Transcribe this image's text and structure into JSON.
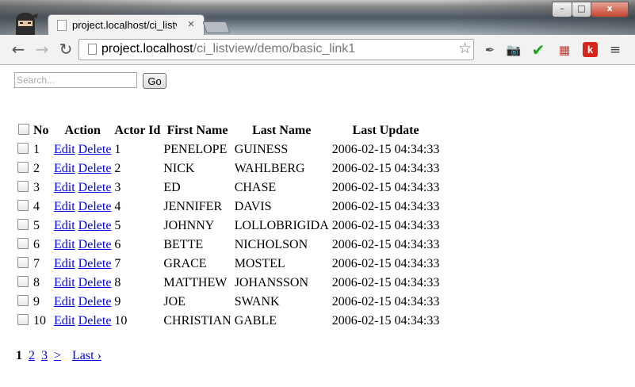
{
  "browser": {
    "tab_title": "project.localhost/ci_listview/demo/basic_link1",
    "tab_close": "×",
    "url_host": "project.localhost",
    "url_path": "/ci_listview/demo/basic_link1",
    "window_buttons": {
      "minimize": "–",
      "maximize": "□",
      "close": "x"
    },
    "nav": {
      "back": "←",
      "forward": "→",
      "reload": "↻"
    },
    "star": "☆",
    "extensions": [
      {
        "name": "eyedropper-extension",
        "glyph": "✒",
        "color": "#555555"
      },
      {
        "name": "camera-extension",
        "glyph": "📷",
        "color": "#2d4e8a"
      },
      {
        "name": "checkmark-extension",
        "glyph": "✔",
        "color": "#1aa51a"
      },
      {
        "name": "colorzilla-extension",
        "glyph": "▦",
        "color": "#c0392b"
      },
      {
        "name": "k-extension",
        "glyph": "k",
        "color": "#ffffff"
      }
    ],
    "menu": "≡"
  },
  "search": {
    "placeholder": "Search...",
    "value": "",
    "go_label": "Go"
  },
  "table": {
    "headers": {
      "no": "No",
      "action": "Action",
      "actor_id": "Actor Id",
      "first_name": "First Name",
      "last_name": "Last Name",
      "last_update": "Last Update"
    },
    "edit_label": "Edit",
    "delete_label": "Delete",
    "rows": [
      {
        "no": "1",
        "actor_id": "1",
        "first_name": "PENELOPE",
        "last_name": "GUINESS",
        "last_update": "2006-02-15 04:34:33"
      },
      {
        "no": "2",
        "actor_id": "2",
        "first_name": "NICK",
        "last_name": "WAHLBERG",
        "last_update": "2006-02-15 04:34:33"
      },
      {
        "no": "3",
        "actor_id": "3",
        "first_name": "ED",
        "last_name": "CHASE",
        "last_update": "2006-02-15 04:34:33"
      },
      {
        "no": "4",
        "actor_id": "4",
        "first_name": "JENNIFER",
        "last_name": "DAVIS",
        "last_update": "2006-02-15 04:34:33"
      },
      {
        "no": "5",
        "actor_id": "5",
        "first_name": "JOHNNY",
        "last_name": "LOLLOBRIGIDA",
        "last_update": "2006-02-15 04:34:33"
      },
      {
        "no": "6",
        "actor_id": "6",
        "first_name": "BETTE",
        "last_name": "NICHOLSON",
        "last_update": "2006-02-15 04:34:33"
      },
      {
        "no": "7",
        "actor_id": "7",
        "first_name": "GRACE",
        "last_name": "MOSTEL",
        "last_update": "2006-02-15 04:34:33"
      },
      {
        "no": "8",
        "actor_id": "8",
        "first_name": "MATTHEW",
        "last_name": "JOHANSSON",
        "last_update": "2006-02-15 04:34:33"
      },
      {
        "no": "9",
        "actor_id": "9",
        "first_name": "JOE",
        "last_name": "SWANK",
        "last_update": "2006-02-15 04:34:33"
      },
      {
        "no": "10",
        "actor_id": "10",
        "first_name": "CHRISTIAN",
        "last_name": "GABLE",
        "last_update": "2006-02-15 04:34:33"
      }
    ]
  },
  "pagination": {
    "current": "1",
    "pages": [
      "2",
      "3"
    ],
    "next": ">",
    "last": "Last ›"
  }
}
